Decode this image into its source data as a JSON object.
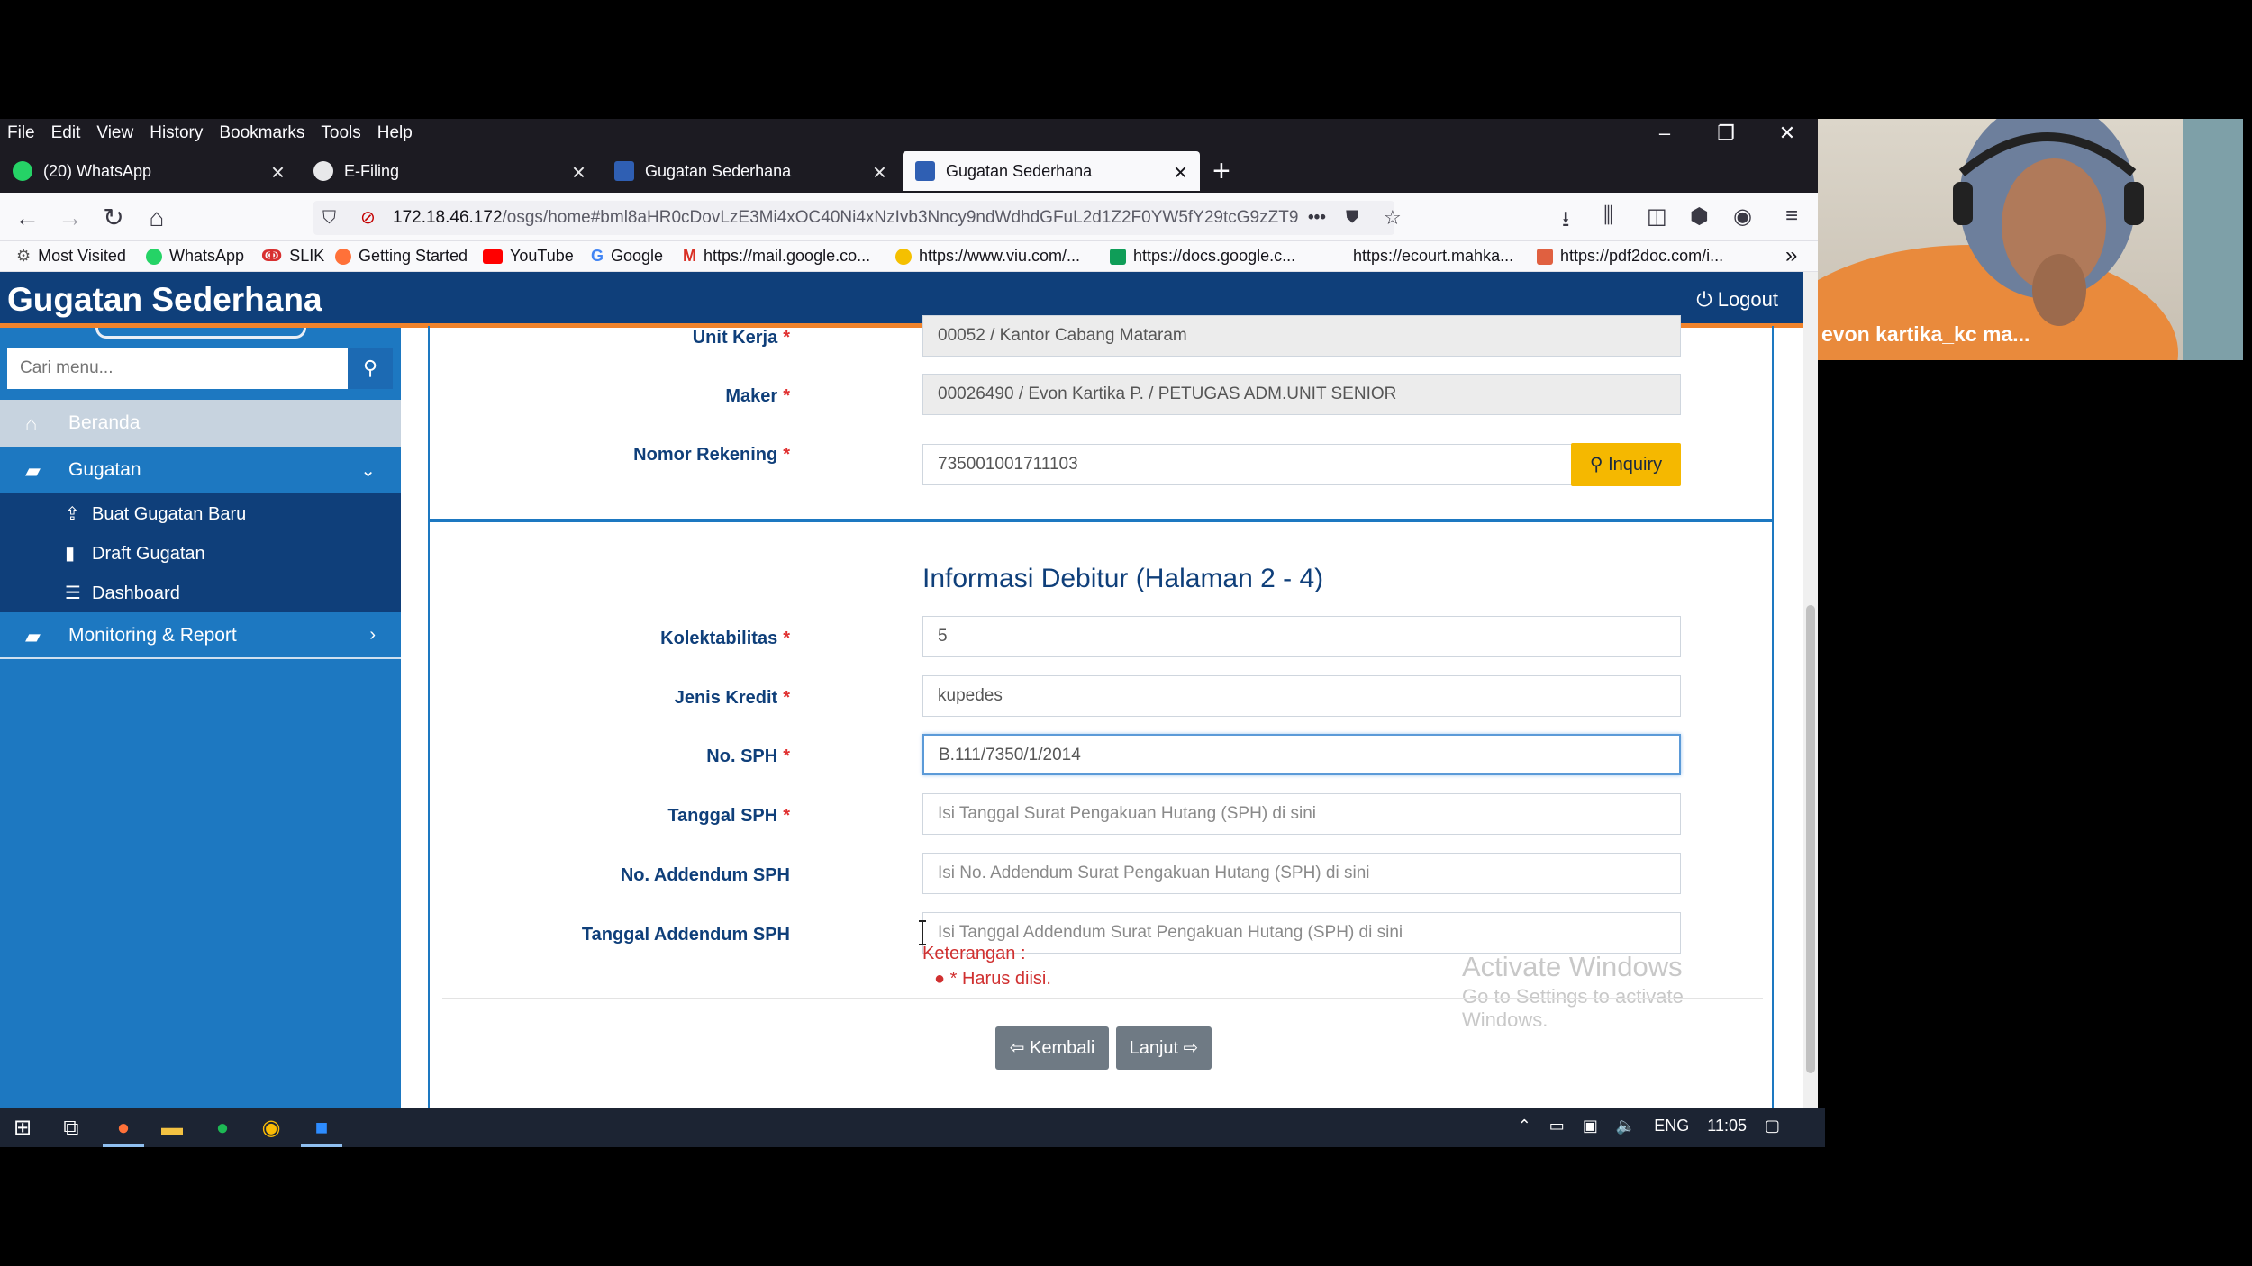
{
  "menubar": {
    "items": [
      "File",
      "Edit",
      "View",
      "History",
      "Bookmarks",
      "Tools",
      "Help"
    ],
    "window_controls": [
      "–",
      "❐",
      "✕"
    ]
  },
  "tabs": [
    {
      "label": "(20) WhatsApp",
      "icon": "whatsapp-icon",
      "color": "#25d366",
      "active": false
    },
    {
      "label": "E-Filing",
      "icon": "globe-icon",
      "color": "#e8e8ea",
      "active": false
    },
    {
      "label": "Gugatan Sederhana",
      "icon": "site-icon",
      "color": "#2f5fb3",
      "active": false
    },
    {
      "label": "Gugatan Sederhana",
      "icon": "site-icon",
      "color": "#2f5fb3",
      "active": true
    }
  ],
  "newtab_label": "+",
  "url": {
    "host": "172.18.46.172",
    "path": "/osgs/home#bml8aHR0cDovLzE3Mi4xOC40Ni4xNzIvb3Nncy9ndWdhdGFuL2d1Z2F0YW5fY29tcG9zZT9"
  },
  "bookmarks": [
    {
      "label": "Most Visited",
      "icon": "gear-icon",
      "color": "#555555"
    },
    {
      "label": "WhatsApp",
      "icon": "whatsapp-icon",
      "color": "#25d366"
    },
    {
      "label": "SLIK",
      "icon": "slik-icon",
      "color": "#d83030"
    },
    {
      "label": "Getting Started",
      "icon": "firefox-icon",
      "color": "#ff7139"
    },
    {
      "label": "YouTube",
      "icon": "youtube-icon",
      "color": "#ff0000"
    },
    {
      "label": "Google",
      "icon": "google-icon",
      "color": "#4285f4"
    },
    {
      "label": "https://mail.google.co...",
      "icon": "gmail-icon",
      "color": "#d93025"
    },
    {
      "label": "https://www.viu.com/...",
      "icon": "viu-icon",
      "color": "#f5c000"
    },
    {
      "label": "https://docs.google.c...",
      "icon": "sheets-icon",
      "color": "#0f9d58"
    },
    {
      "label": "https://ecourt.mahka...",
      "icon": "none",
      "color": "#f9f9fb"
    },
    {
      "label": "https://pdf2doc.com/i...",
      "icon": "pdf-icon",
      "color": "#e06040"
    }
  ],
  "app": {
    "title": "Gugatan Sederhana",
    "logout": "Logout",
    "header_color": "#0f3f7a",
    "accent_color": "#f0832b"
  },
  "sidebar": {
    "search_placeholder": "Cari menu...",
    "items": [
      {
        "label": "Beranda",
        "icon": "home-icon"
      },
      {
        "label": "Gugatan",
        "icon": "folder-open-icon",
        "chevron": "⌄"
      },
      {
        "label": "Monitoring & Report",
        "icon": "folder-icon",
        "chevron": "›"
      }
    ],
    "subitems": [
      {
        "label": "Buat Gugatan Baru",
        "icon": "upload-icon"
      },
      {
        "label": "Draft Gugatan",
        "icon": "file-icon"
      },
      {
        "label": "Dashboard",
        "icon": "list-icon"
      }
    ]
  },
  "form_top": {
    "unit_kerja": {
      "label": "Unit Kerja",
      "value": "00052 / Kantor Cabang Mataram"
    },
    "maker": {
      "label": "Maker",
      "value": "00026490 / Evon Kartika P. / PETUGAS ADM.UNIT SENIOR"
    },
    "nomor_rekening": {
      "label": "Nomor Rekening",
      "value": "735001001711103"
    },
    "inquiry_label": "Inquiry"
  },
  "form_debitur": {
    "title": "Informasi Debitur (Halaman 2 - 4)",
    "kolektabilitas": {
      "label": "Kolektabilitas",
      "value": "5"
    },
    "jenis_kredit": {
      "label": "Jenis Kredit",
      "value": "kupedes"
    },
    "no_sph": {
      "label": "No. SPH",
      "value": "B.111/7350/1/2014"
    },
    "tanggal_sph": {
      "label": "Tanggal SPH",
      "placeholder": "Isi Tanggal Surat Pengakuan Hutang (SPH) di sini"
    },
    "no_addendum": {
      "label": "No. Addendum SPH",
      "placeholder": "Isi No. Addendum Surat Pengakuan Hutang (SPH) di sini"
    },
    "tanggal_addendum": {
      "label": "Tanggal Addendum SPH",
      "placeholder": "Isi Tanggal Addendum Surat Pengakuan Hutang (SPH) di sini"
    },
    "keterangan_label": "Keterangan :",
    "keterangan_item": "* Harus diisi.",
    "required_mark": "*"
  },
  "actions": {
    "back": "Kembali",
    "next": "Lanjut"
  },
  "watermark": {
    "line1": "Activate Windows",
    "line2": "Go to Settings to activate Windows."
  },
  "taskbar": {
    "lang": "ENG",
    "time": "11:05"
  },
  "webcam": {
    "name": "evon kartika_kc ma..."
  }
}
